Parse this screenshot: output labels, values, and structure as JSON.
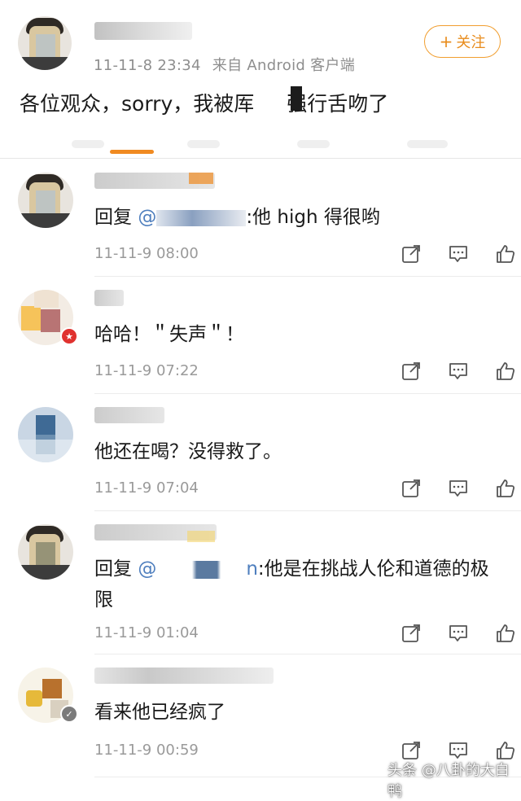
{
  "post": {
    "timestamp": "11-11-8 23:34",
    "source": "来自 Android 客户端",
    "follow_label": "关注",
    "text_before": "各位观众，sorry，我被",
    "text_mid": "厍",
    "text_after": "强行舌吻了"
  },
  "comments": [
    {
      "reply_prefix": "回复 ",
      "mention": "@",
      "text": ":他 high 得很哟",
      "time": "11-11-9 08:00"
    },
    {
      "text": "哈哈！＂失声＂！",
      "time": "11-11-9 07:22"
    },
    {
      "text": "他还在喝？没得救了。",
      "time": "11-11-9 07:04"
    },
    {
      "reply_prefix": "回复 ",
      "mention": "@",
      "mention_tail": "n",
      "text": ":他是在挑战人伦和道德的极限",
      "time": "11-11-9 01:04"
    },
    {
      "text": "看来他已经疯了",
      "time": "11-11-9 00:59"
    }
  ],
  "icons": [
    "share-icon",
    "comment-icon",
    "like-icon",
    "plus-icon"
  ],
  "colors": {
    "accent": "#f08a21",
    "mention": "#4f7fbe",
    "meta": "#8e8e8e"
  },
  "watermark": "头条 @八卦的大白鸭"
}
